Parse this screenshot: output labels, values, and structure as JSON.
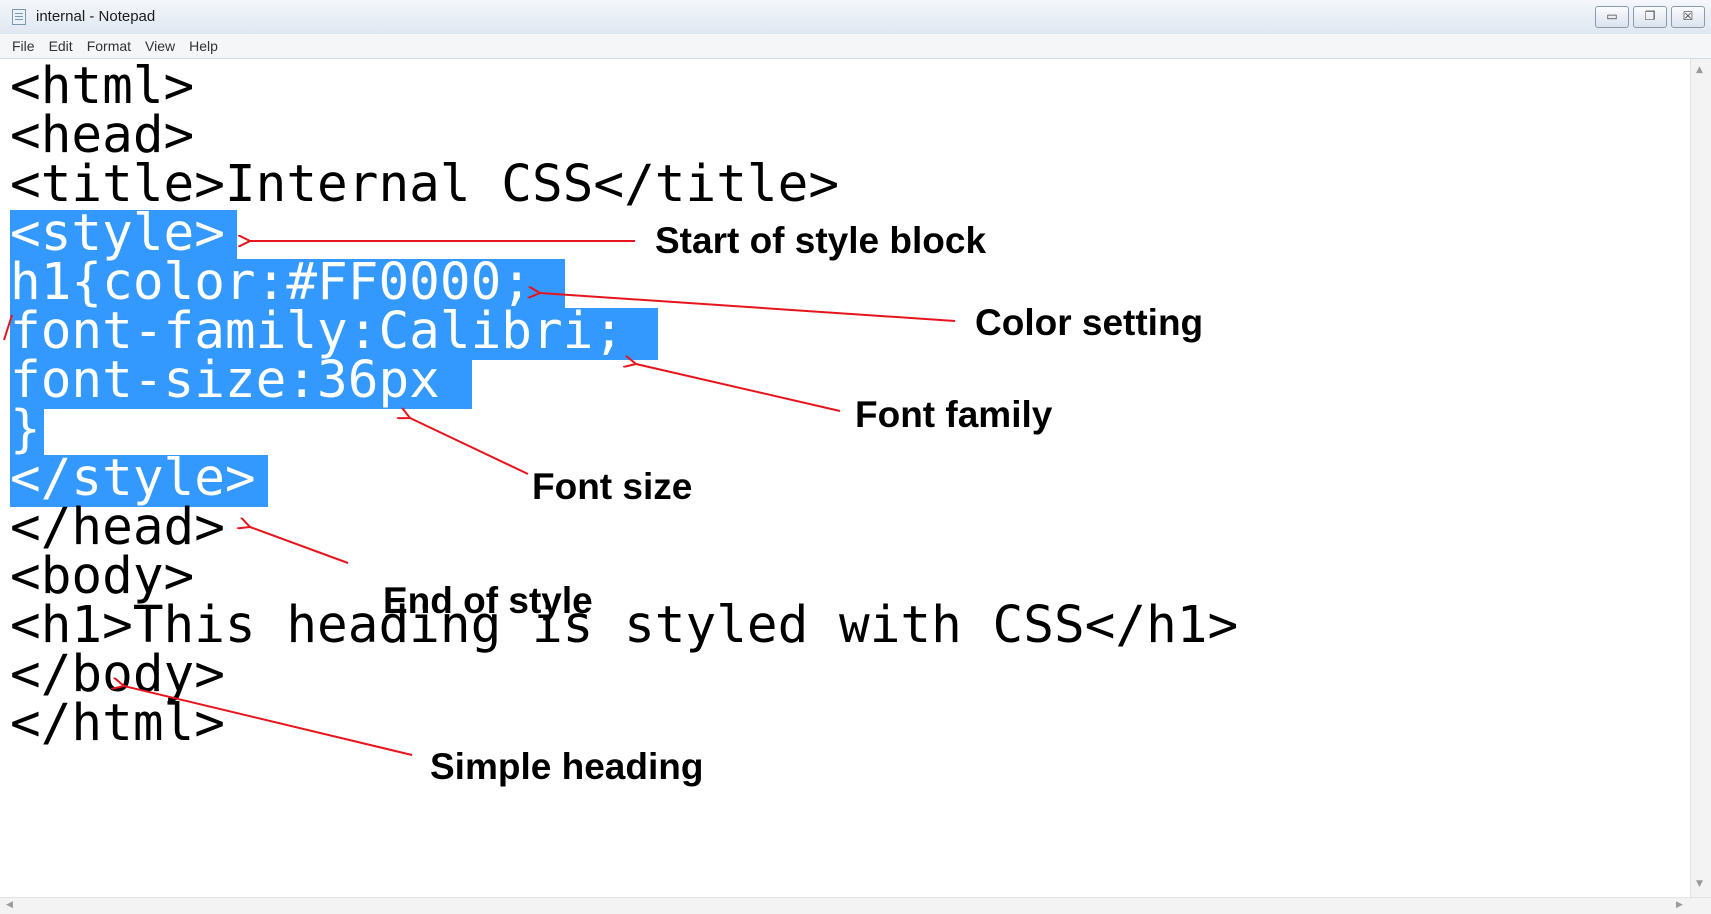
{
  "window": {
    "title": "internal - Notepad",
    "minimize_glyph": "▭",
    "restore_glyph": "❐",
    "close_glyph": "☒"
  },
  "menu": [
    "File",
    "Edit",
    "Format",
    "View",
    "Help"
  ],
  "editor": {
    "lines": [
      "<html>",
      "<head>",
      "<title>Internal CSS</title>",
      "<style>",
      "h1{color:#FF0000;",
      "font-family:Calibri;",
      "font-size:36px",
      "}",
      "</style>",
      "</head>",
      "<body>",
      "<h1>This heading is styled with CSS</h1>",
      "</body>",
      "</html>"
    ],
    "selection_color": "#3399ff"
  },
  "annotations": {
    "start_style": "Start of style block",
    "color_setting": "Color setting",
    "font_family": "Font family",
    "font_size": "Font size",
    "end_style": "End of style",
    "simple_heading": "Simple heading",
    "arrow_color": "#e8141b"
  },
  "scroll": {
    "up": "▲",
    "down": "▼",
    "left": "◀",
    "right": "▶"
  }
}
